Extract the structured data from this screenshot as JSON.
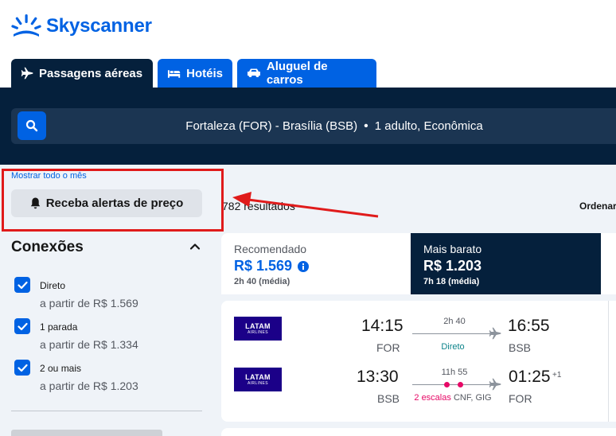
{
  "brand": {
    "name": "Skyscanner",
    "color": "#0062e3"
  },
  "tabs": [
    {
      "label": "Passagens aéreas",
      "icon": "plane-icon",
      "active": true
    },
    {
      "label": "Hotéis",
      "icon": "bed-icon",
      "active": false
    },
    {
      "label": "Aluguel de carros",
      "icon": "car-icon",
      "active": false
    }
  ],
  "search": {
    "summary": "Fortaleza (FOR) - Brasília (BSB)",
    "separator": "•",
    "passengers": "1 adulto, Econômica"
  },
  "toolbar": {
    "show_month": "Mostrar todo o mês",
    "price_alert": "Receba alertas de preço",
    "results_count": "782 resultados",
    "sort_label": "Ordenar"
  },
  "filters": {
    "connections": {
      "title": "Conexões",
      "options": [
        {
          "label": "Direto",
          "price": "a partir de R$ 1.569",
          "checked": true
        },
        {
          "label": "1 parada",
          "price": "a partir de R$ 1.334",
          "checked": true
        },
        {
          "label": "2 ou mais",
          "price": "a partir de R$ 1.203",
          "checked": true
        }
      ]
    }
  },
  "sort_tabs": [
    {
      "label": "Recomendado",
      "price": "R$ 1.569",
      "duration": "2h 40 (média)"
    },
    {
      "label": "Mais barato",
      "price": "R$ 1.203",
      "duration": "7h 18 (média)"
    }
  ],
  "results": [
    {
      "legs": [
        {
          "airline": "LATAM",
          "airline_sub": "AIRLINES",
          "dep_time": "14:15",
          "dep_code": "FOR",
          "arr_time": "16:55",
          "arr_code": "BSB",
          "duration": "2h 40",
          "stops": "Direto",
          "stops_via": "",
          "day_offset": ""
        },
        {
          "airline": "LATAM",
          "airline_sub": "AIRLINES",
          "dep_time": "13:30",
          "dep_code": "BSB",
          "arr_time": "01:25",
          "arr_code": "FOR",
          "duration": "11h 55",
          "stops": "2 escalas",
          "stops_via": "CNF, GIG",
          "day_offset": "+1"
        }
      ]
    }
  ],
  "colors": {
    "navy": "#05203c",
    "blue": "#0062e3",
    "green": "#0c838a",
    "red": "#e70866",
    "alert_box": "#e01b1b"
  }
}
